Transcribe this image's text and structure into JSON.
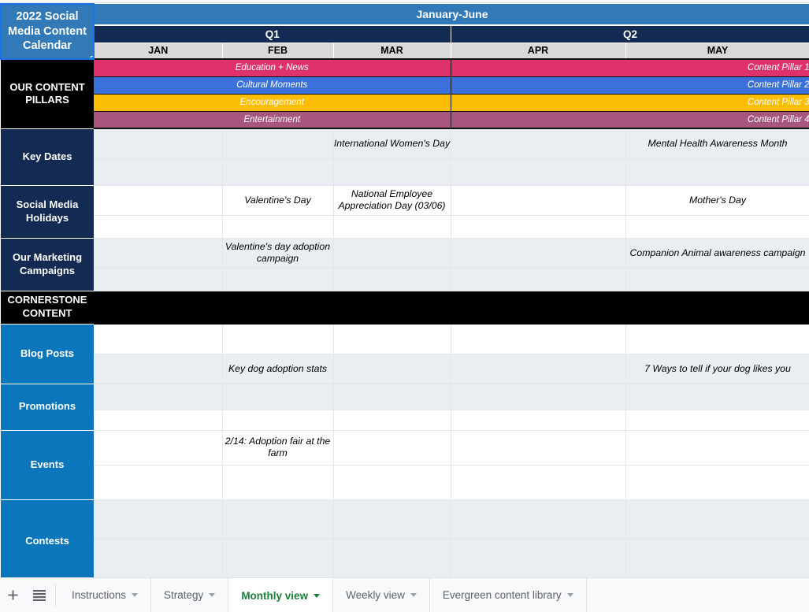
{
  "sheet": {
    "title": "2022 Social Media Content Calendar",
    "range_header": "January-June",
    "quarters": [
      {
        "label": "Q1",
        "span": 3
      },
      {
        "label": "Q2",
        "span": 2
      }
    ],
    "months": [
      "JAN",
      "FEB",
      "MAR",
      "APR",
      "MAY"
    ],
    "pillars_label": "OUR CONTENT PILLARS",
    "pillars": [
      {
        "q1_label": "Education + News",
        "q2_label": "Content Pillar 1",
        "color": "#e0326a"
      },
      {
        "q1_label": "Cultural Moments",
        "q2_label": "Content Pillar 2",
        "color": "#3b72d9"
      },
      {
        "q1_label": "Encouragement",
        "q2_label": "Content Pillar 3",
        "color": "#fbbc04"
      },
      {
        "q1_label": "Entertainment",
        "q2_label": "Content Pillar 4",
        "color": "#a6567f"
      }
    ],
    "sections": [
      {
        "name": "key-dates",
        "label": "Key Dates",
        "style": "navy",
        "rows": [
          {
            "band": true,
            "height": 38,
            "cells": [
              "",
              "",
              "International Women's Day",
              "",
              "Mental Health Awareness Month"
            ]
          },
          {
            "band": true,
            "height": 34,
            "cells": [
              "",
              "",
              "",
              "",
              ""
            ]
          }
        ]
      },
      {
        "name": "social-media-holidays",
        "label": "Social Media Holidays",
        "style": "navy",
        "rows": [
          {
            "band": false,
            "height": 38,
            "cells": [
              "",
              "Valentine's Day",
              "National Employee Appreciation Day (03/06)",
              "",
              "Mother's Day"
            ]
          },
          {
            "band": false,
            "height": 29,
            "cells": [
              "",
              "",
              "",
              "",
              ""
            ]
          }
        ]
      },
      {
        "name": "our-marketing-campaigns",
        "label": "Our Marketing Campaigns",
        "style": "navy",
        "rows": [
          {
            "band": true,
            "height": 38,
            "cells": [
              "",
              "Valentine's day adoption campaign",
              "",
              "",
              "Companion Animal awareness campaign"
            ]
          },
          {
            "band": true,
            "height": 29,
            "cells": [
              "",
              "",
              "",
              "",
              ""
            ]
          }
        ]
      },
      {
        "name": "cornerstone-content",
        "label": "CORNERSTONE CONTENT",
        "style": "black",
        "rows": [
          {
            "band": false,
            "black": true,
            "height": 21,
            "cells": [
              "",
              "",
              "",
              "",
              ""
            ]
          },
          {
            "band": false,
            "black": true,
            "height": 21,
            "cells": [
              "",
              "",
              "",
              "",
              ""
            ]
          }
        ]
      },
      {
        "name": "blog-posts",
        "label": "Blog Posts",
        "style": "blue",
        "rows": [
          {
            "band": false,
            "height": 38,
            "cells": [
              "",
              "",
              "",
              "",
              ""
            ]
          },
          {
            "band": true,
            "height": 38,
            "cells": [
              "",
              "Key dog adoption stats",
              "",
              "",
              "7 Ways to tell if your dog likes you"
            ]
          }
        ]
      },
      {
        "name": "promotions",
        "label": "Promotions",
        "style": "blue",
        "rows": [
          {
            "band": true,
            "height": 33,
            "cells": [
              "",
              "",
              "",
              "",
              ""
            ]
          },
          {
            "band": false,
            "height": 26,
            "cells": [
              "",
              "",
              "",
              "",
              ""
            ]
          }
        ]
      },
      {
        "name": "events",
        "label": "Events",
        "style": "blue",
        "rows": [
          {
            "band": false,
            "height": 44,
            "cells": [
              "",
              "2/14: Adoption fair at the farm",
              "",
              "",
              ""
            ]
          },
          {
            "band": false,
            "height": 44,
            "cells": [
              "",
              "",
              "",
              "",
              ""
            ]
          }
        ]
      },
      {
        "name": "contests",
        "label": "Contests",
        "style": "blue",
        "rows": [
          {
            "band": true,
            "height": 50,
            "cells": [
              "",
              "",
              "",
              "",
              ""
            ]
          },
          {
            "band": true,
            "height": 56,
            "cells": [
              "",
              "",
              "",
              "",
              ""
            ]
          }
        ]
      }
    ]
  },
  "tabbar": {
    "add_sheet_icon": "plus-icon",
    "all_sheets_icon": "hamburger-icon",
    "tabs": [
      {
        "label": "Instructions",
        "active": false
      },
      {
        "label": "Strategy",
        "active": false
      },
      {
        "label": "Monthly view",
        "active": true
      },
      {
        "label": "Weekly view",
        "active": false
      },
      {
        "label": "Evergreen content library",
        "active": false
      }
    ]
  },
  "scrollbar": {
    "orientation": "horizontal",
    "thumb_position_pct": 0,
    "thumb_width_pct": 56
  }
}
